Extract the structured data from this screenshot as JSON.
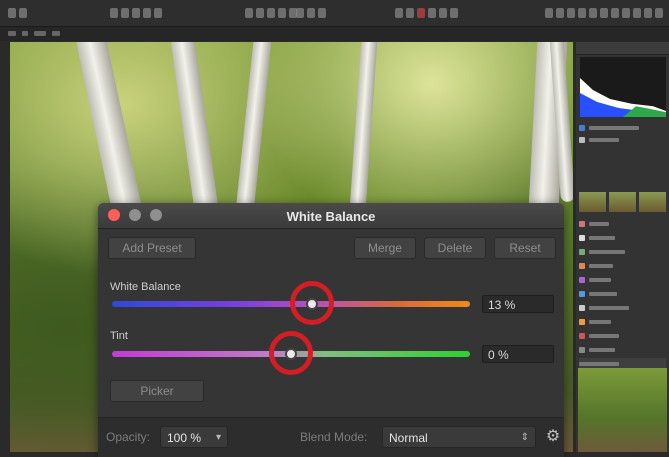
{
  "dialog": {
    "title": "White Balance",
    "buttons": {
      "add_preset": "Add Preset",
      "merge": "Merge",
      "delete": "Delete",
      "reset": "Reset",
      "picker": "Picker"
    },
    "white_balance": {
      "label": "White Balance",
      "value": "13 %",
      "level": 0.56
    },
    "tint": {
      "label": "Tint",
      "value": "0 %",
      "level": 0.5
    },
    "opacity": {
      "label": "Opacity:",
      "value": "100 %"
    },
    "blend_mode": {
      "label": "Blend Mode:",
      "value": "Normal"
    },
    "window_controls": {
      "close": "#ff5f57",
      "minimize": "#8f8f8f",
      "zoom": "#8f8f8f"
    }
  },
  "colors": {
    "annotation_ring": "#d21f26",
    "dialog_bg": "#353535"
  }
}
